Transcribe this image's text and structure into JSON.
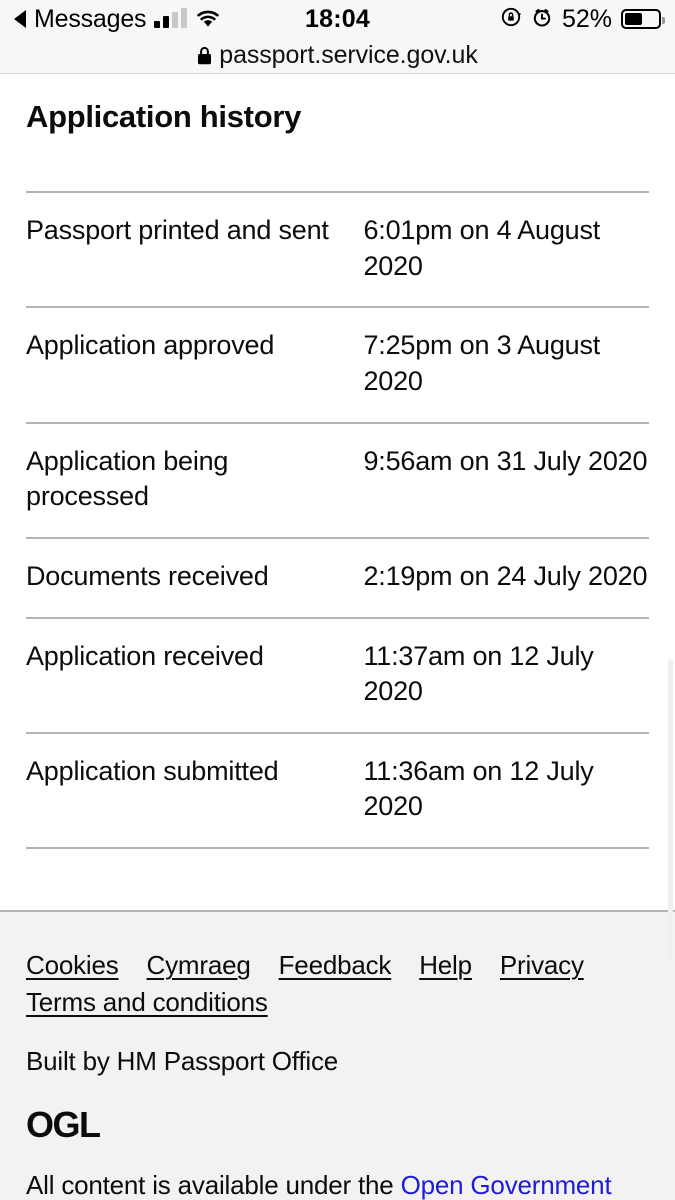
{
  "status_bar": {
    "back_label": "Messages",
    "back_icon": "back-triangle-icon",
    "signal_icon": "cellular-signal-icon",
    "wifi_icon": "wifi-icon",
    "time": "18:04",
    "rotation_lock_icon": "rotation-lock-icon",
    "alarm_icon": "alarm-clock-icon",
    "battery_percent": "52%",
    "battery_icon": "battery-icon",
    "battery_level": 52
  },
  "browser": {
    "lock_icon": "lock-icon",
    "url": "passport.service.gov.uk"
  },
  "main": {
    "title": "Application history",
    "history": [
      {
        "event": "Passport printed and sent",
        "time": "6:01pm on 4 August 2020"
      },
      {
        "event": "Application approved",
        "time": "7:25pm on 3 August 2020"
      },
      {
        "event": "Application being processed",
        "time": "9:56am on 31 July 2020"
      },
      {
        "event": "Documents received",
        "time": "2:19pm on 24 July 2020"
      },
      {
        "event": "Application received",
        "time": "11:37am on 12 July 2020"
      },
      {
        "event": "Application submitted",
        "time": "11:36am on 12 July 2020"
      }
    ]
  },
  "footer": {
    "links": [
      "Cookies",
      "Cymraeg",
      "Feedback",
      "Help",
      "Privacy",
      "Terms and conditions"
    ],
    "built_by": "Built by HM Passport Office",
    "ogl_logo": "OGL",
    "licence_prefix": "All content is available under the ",
    "licence_link": "Open Government"
  },
  "colors": {
    "text": "#0b0c0c",
    "rule": "#b1b4b6",
    "footer_bg": "#f3f2f1",
    "link_blue": "#1d1dd6",
    "chrome_bg": "#f7f7f7"
  }
}
